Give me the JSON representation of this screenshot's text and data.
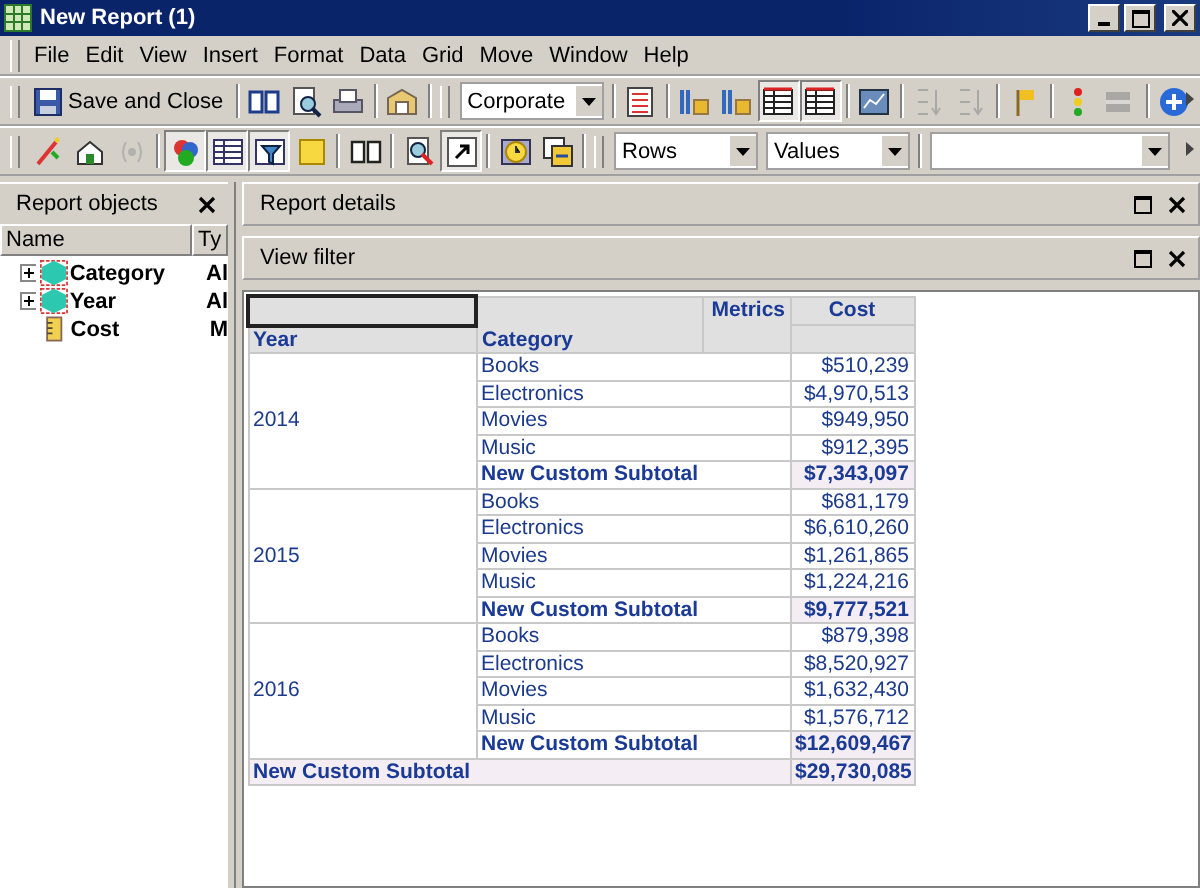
{
  "window": {
    "title": "New Report (1)"
  },
  "menu": [
    "File",
    "Edit",
    "View",
    "Insert",
    "Format",
    "Data",
    "Grid",
    "Move",
    "Window",
    "Help"
  ],
  "toolbar_1": {
    "save_label": "Save and Close",
    "groups": [
      [
        {
          "kind": "book",
          "pressed": false,
          "disabled": false
        },
        {
          "kind": "preview",
          "pressed": false,
          "disabled": false
        },
        {
          "kind": "print",
          "pressed": false,
          "disabled": false
        }
      ],
      [
        {
          "kind": "folder",
          "pressed": false,
          "disabled": false
        }
      ]
    ],
    "template": "Corporate",
    "groups_2": [
      [
        {
          "kind": "list",
          "pressed": false,
          "disabled": false
        }
      ],
      [
        {
          "kind": "lock",
          "pressed": false,
          "disabled": false
        },
        {
          "kind": "lock",
          "pressed": false,
          "disabled": false
        },
        {
          "kind": "table",
          "pressed": true,
          "disabled": false
        },
        {
          "kind": "table",
          "pressed": true,
          "disabled": false
        }
      ],
      [
        {
          "kind": "chart",
          "pressed": false,
          "disabled": false
        }
      ],
      [
        {
          "kind": "sort",
          "pressed": false,
          "disabled": true
        },
        {
          "kind": "sort",
          "pressed": false,
          "disabled": true
        }
      ],
      [
        {
          "kind": "flag",
          "pressed": false,
          "disabled": false
        }
      ],
      [
        {
          "kind": "light",
          "pressed": false,
          "disabled": false
        },
        {
          "kind": "bar",
          "pressed": false,
          "disabled": true
        }
      ],
      [
        {
          "kind": "plus",
          "pressed": false,
          "disabled": false
        }
      ]
    ]
  },
  "toolbar_2": {
    "groups": [
      [
        {
          "kind": "wand",
          "pressed": false,
          "disabled": false
        },
        {
          "kind": "house",
          "pressed": false,
          "disabled": false
        },
        {
          "kind": "help",
          "pressed": false,
          "disabled": true
        }
      ],
      [
        {
          "kind": "pie",
          "pressed": true,
          "disabled": false
        },
        {
          "kind": "grid",
          "pressed": true,
          "disabled": false
        },
        {
          "kind": "filter",
          "pressed": true,
          "disabled": false
        },
        {
          "kind": "note",
          "pressed": false,
          "disabled": false
        }
      ],
      [
        {
          "kind": "book2",
          "pressed": false,
          "disabled": false
        }
      ],
      [
        {
          "kind": "zoom",
          "pressed": false,
          "disabled": false
        },
        {
          "kind": "arrow",
          "pressed": true,
          "disabled": false
        }
      ],
      [
        {
          "kind": "clock",
          "pressed": false,
          "disabled": false
        },
        {
          "kind": "swap",
          "pressed": false,
          "disabled": false
        }
      ]
    ],
    "dropdowns": [
      "Rows",
      "Values"
    ]
  },
  "report_objects": {
    "title": "Report objects",
    "columns": [
      "Name",
      "Ty"
    ],
    "items": [
      {
        "name": "Category",
        "type": "Al",
        "kind": "attribute"
      },
      {
        "name": "Year",
        "type": "Al",
        "kind": "attribute"
      },
      {
        "name": "Cost",
        "type": "M",
        "kind": "metric"
      }
    ]
  },
  "panels": [
    "Report details",
    "View filter"
  ],
  "grid": {
    "header": {
      "metrics": "Metrics",
      "cost": "Cost",
      "year": "Year",
      "category": "Category"
    },
    "groups": [
      {
        "year": "2014",
        "rows": [
          {
            "category": "Books",
            "cost": "$510,239"
          },
          {
            "category": "Electronics",
            "cost": "$4,970,513"
          },
          {
            "category": "Movies",
            "cost": "$949,950"
          },
          {
            "category": "Music",
            "cost": "$912,395"
          }
        ],
        "subtotal_label": "New Custom Subtotal",
        "subtotal": "$7,343,097"
      },
      {
        "year": "2015",
        "rows": [
          {
            "category": "Books",
            "cost": "$681,179"
          },
          {
            "category": "Electronics",
            "cost": "$6,610,260"
          },
          {
            "category": "Movies",
            "cost": "$1,261,865"
          },
          {
            "category": "Music",
            "cost": "$1,224,216"
          }
        ],
        "subtotal_label": "New Custom Subtotal",
        "subtotal": "$9,777,521"
      },
      {
        "year": "2016",
        "rows": [
          {
            "category": "Books",
            "cost": "$879,398"
          },
          {
            "category": "Electronics",
            "cost": "$8,520,927"
          },
          {
            "category": "Movies",
            "cost": "$1,632,430"
          },
          {
            "category": "Music",
            "cost": "$1,576,712"
          }
        ],
        "subtotal_label": "New Custom Subtotal",
        "subtotal": "$12,609,467"
      }
    ],
    "total_label": "New Custom Subtotal",
    "total": "$29,730,085"
  }
}
